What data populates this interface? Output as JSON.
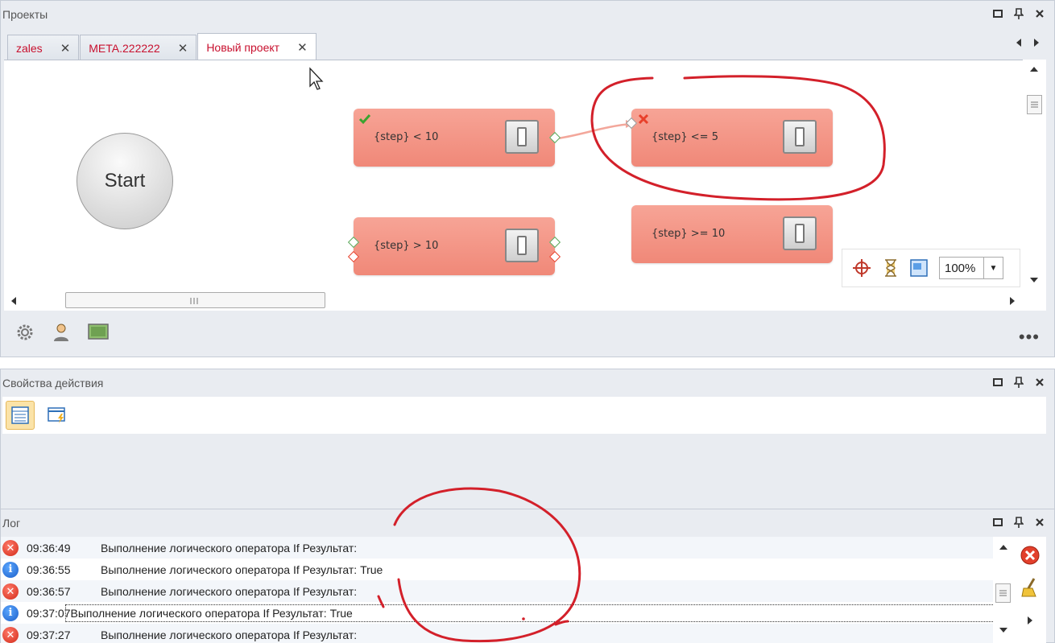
{
  "projects_panel": {
    "title": "Проекты",
    "tabs": [
      {
        "label": "zales"
      },
      {
        "label": "META.222222"
      },
      {
        "label": "Новый проект",
        "active": true
      }
    ]
  },
  "canvas": {
    "start_label": "Start",
    "nodes": [
      {
        "label": "{step} < 10"
      },
      {
        "label": "{step} <= 5"
      },
      {
        "label": "{step} > 10"
      },
      {
        "label": "{step} >= 10"
      }
    ],
    "zoom": "100%"
  },
  "properties_panel": {
    "title": "Свойства действия"
  },
  "log_panel": {
    "title": "Лог",
    "rows": [
      {
        "type": "error",
        "time": "09:36:49",
        "message": "Выполнение логического оператора If  Результат:"
      },
      {
        "type": "info",
        "time": "09:36:55",
        "message": "Выполнение логического оператора If  Результат: True"
      },
      {
        "type": "error",
        "time": "09:36:57",
        "message": "Выполнение логического оператора If  Результат:"
      },
      {
        "type": "info",
        "time": "09:37:07",
        "message": "Выполнение логического оператора If  Результат: True"
      },
      {
        "type": "error",
        "time": "09:37:27",
        "message": "Выполнение логического оператора If  Результат:"
      }
    ]
  },
  "colors": {
    "node_fill": "#f08878",
    "tab_text": "#c8102e",
    "annotation": "#d3202a"
  }
}
